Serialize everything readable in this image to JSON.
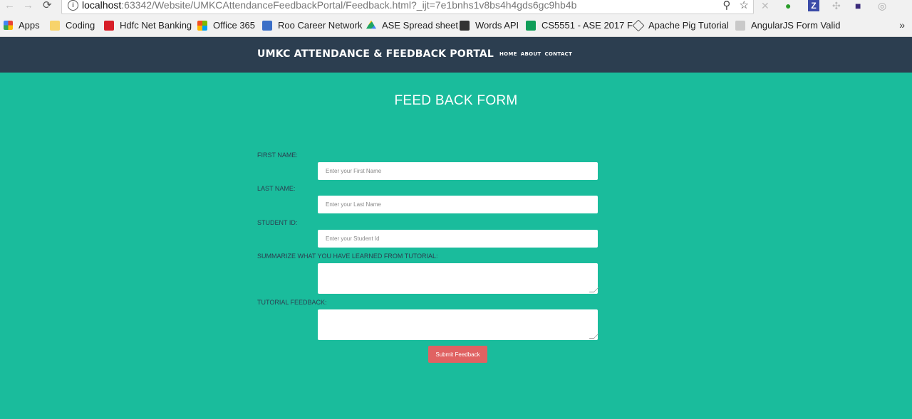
{
  "browser": {
    "url_host": "localhost",
    "url_path": ":63342/Website/UMKCAttendanceFeedbackPortal/Feedback.html?_ijt=7e1bnhs1v8bs4h4gds6gc9hb4b",
    "bookmarks": [
      {
        "label": "Apps",
        "icon": "apps-grid-icon",
        "color": "#e94235"
      },
      {
        "label": "Coding",
        "icon": "folder-icon",
        "color": "#f7d36b"
      },
      {
        "label": "Hdfc Net Banking",
        "icon": "hdfc-icon",
        "color": "#d71e28"
      },
      {
        "label": "Office 365",
        "icon": "office-icon",
        "color": "#f25022"
      },
      {
        "label": "Roo Career Network",
        "icon": "roo-icon",
        "color": "#3b6fc7"
      },
      {
        "label": "ASE Spread sheet",
        "icon": "drive-icon",
        "color": "#1fa463"
      },
      {
        "label": "Words API",
        "icon": "words-api-icon",
        "color": "#333333"
      },
      {
        "label": "CS5551 - ASE 2017 F",
        "icon": "sheets-icon",
        "color": "#0f9d58"
      },
      {
        "label": "Apache Pig Tutorial",
        "icon": "pig-icon",
        "color": "#555555"
      },
      {
        "label": "AngularJS Form Valid",
        "icon": "angular-icon",
        "color": "#999999"
      }
    ],
    "more": "»"
  },
  "site": {
    "brand": "UMKC ATTENDANCE & FEEDBACK PORTAL",
    "menu": [
      "HOME",
      "ABOUT",
      "CONTACT"
    ]
  },
  "form": {
    "title": "FEED BACK FORM",
    "first_name_label": "FIRST NAME:",
    "first_name_placeholder": "Enter your First Name",
    "last_name_label": "LAST NAME:",
    "last_name_placeholder": "Enter your Last Name",
    "student_id_label": "STUDENT ID:",
    "student_id_placeholder": "Enter your Student Id",
    "summary_label": "SUMMARIZE WHAT YOU HAVE LEARNED FROM TUTORIAL:",
    "feedback_label": "TUTORIAL FEEDBACK:",
    "submit_label": "Submit Feedback"
  },
  "colors": {
    "background": "#1abc9c",
    "header": "#2c3e50",
    "submit": "#e06262"
  }
}
